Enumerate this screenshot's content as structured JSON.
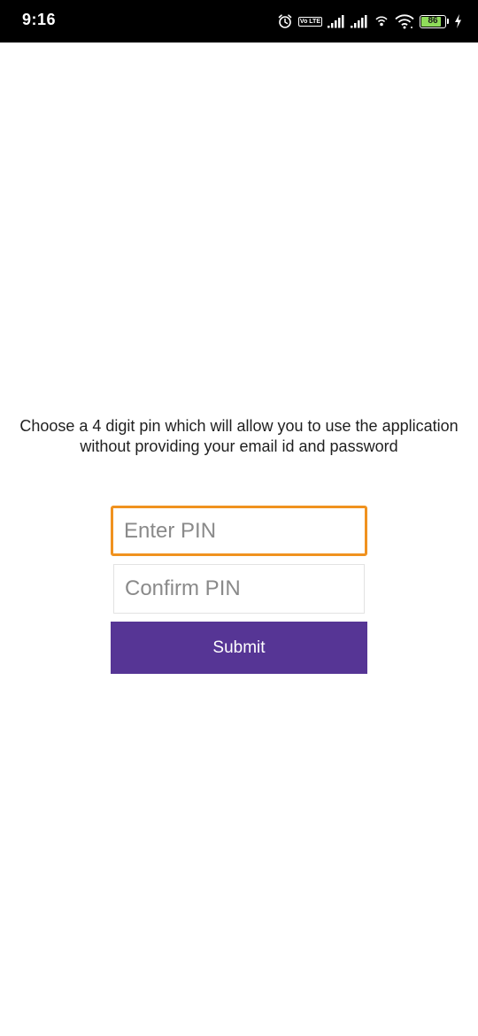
{
  "status_bar": {
    "time": "9:16",
    "volte_label": "Vo LTE",
    "battery_level": "86",
    "icons": [
      "alarm-icon",
      "volte-icon",
      "signal-icon",
      "signal-icon",
      "hotspot-icon",
      "wifi-icon",
      "battery-icon",
      "charging-icon"
    ]
  },
  "instruction": "Choose a 4 digit pin which will allow you to use the application without providing your email id and password",
  "enter_pin": {
    "value": "",
    "placeholder": "Enter PIN"
  },
  "confirm_pin": {
    "value": "",
    "placeholder": "Confirm PIN"
  },
  "submit_label": "Submit",
  "colors": {
    "accent": "#563595",
    "focus_border": "#f0921f",
    "status_bar": "#000000",
    "battery_fill": "#8fdc5a"
  }
}
